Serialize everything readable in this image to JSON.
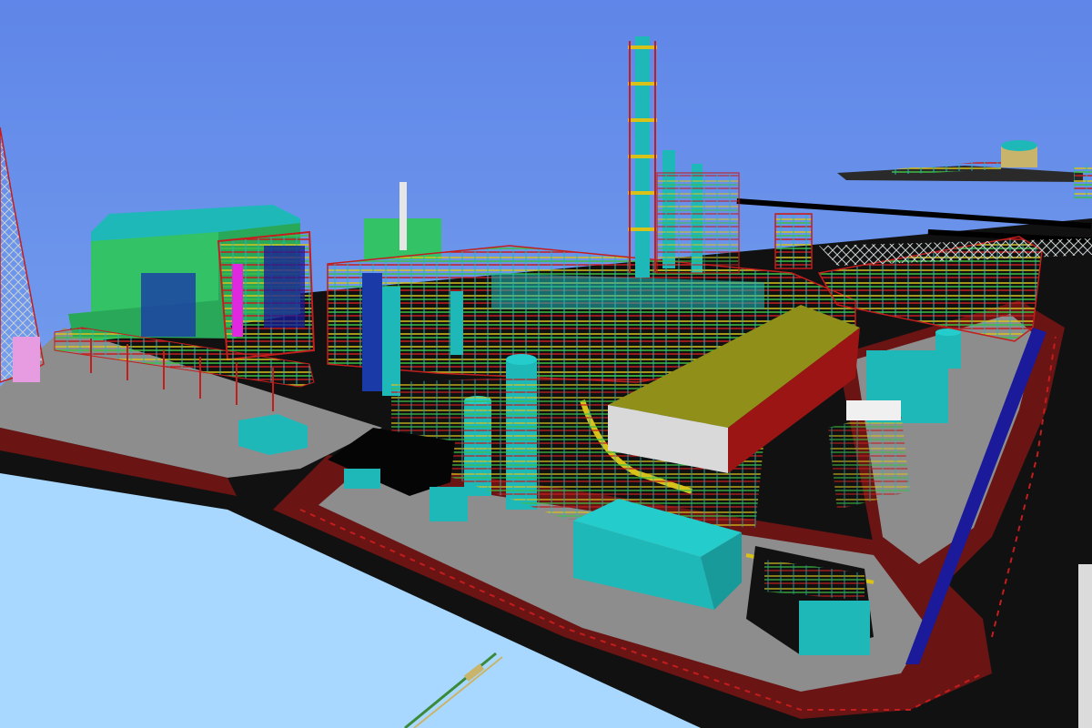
{
  "scene": {
    "kind": "3d-plant-model-render",
    "description_tags": [
      "refinery",
      "pipe-racks",
      "distillation-columns",
      "warehouse-shed",
      "substation"
    ],
    "colors": {
      "sky_top": "#5f86e8",
      "sky_bottom": "#9fd0ff",
      "ground": "#111111",
      "concrete": "#8d8d8d",
      "curb_red": "#6a1414",
      "equipment_cyan": "#1fb8b8",
      "steel_red": "#c41d1d",
      "pipe_yellow": "#d8c21a",
      "pipe_green": "#3fbf3f",
      "roof_olive": "#8f8f1a",
      "building_green": "#33c266",
      "magenta": "#e028e0",
      "navy": "#1a1a9a"
    }
  }
}
